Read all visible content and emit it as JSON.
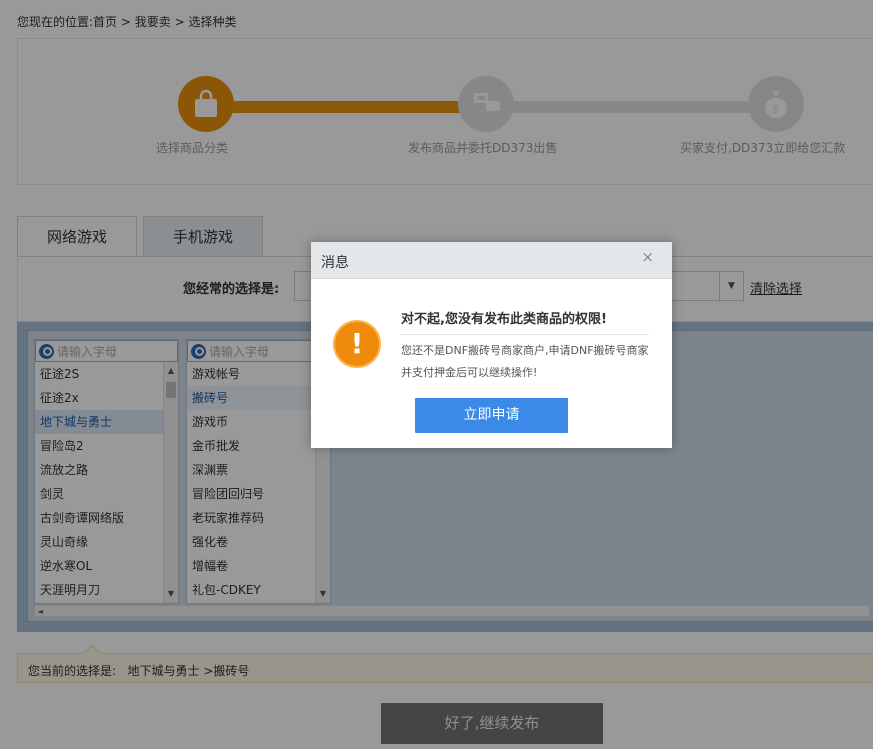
{
  "breadcrumb": {
    "prefix": "您现在的位置:",
    "home": "首页",
    "sep1": ">",
    "sell": "我要卖",
    "sep2": ">",
    "current": "选择种类"
  },
  "steps": [
    {
      "label": "选择商品分类",
      "icon": "shopping-bag-icon",
      "active": true
    },
    {
      "label": "发布商品并委托DD373出售",
      "icon": "handshake-icon",
      "active": false
    },
    {
      "label": "买家支付,DD373立即给您汇款",
      "icon": "money-bag-icon",
      "active": false
    }
  ],
  "tabs": {
    "online_games": "网络游戏",
    "mobile_games": "手机游戏"
  },
  "frequent": {
    "label": "您经常的选择是:",
    "clear_link": "清除选择"
  },
  "list_games": {
    "placeholder": "请输入字母",
    "items": [
      "征途2S",
      "征途2x",
      "地下城与勇士",
      "冒险岛2",
      "流放之路",
      "剑灵",
      "古剑奇谭网络版",
      "灵山奇缘",
      "逆水寒OL",
      "天涯明月刀"
    ],
    "selected_index": 2
  },
  "list_types": {
    "placeholder": "请输入字母",
    "items": [
      "游戏帐号",
      "搬砖号",
      "游戏币",
      "金币批发",
      "深渊票",
      "冒险团回归号",
      "老玩家推荐码",
      "强化卷",
      "增幅卷",
      "礼包-CDKEY"
    ],
    "selected_index": 1
  },
  "current_selection": {
    "label": "您当前的选择是:",
    "value": "地下城与勇士 >搬砖号"
  },
  "continue_button": "好了,继续发布",
  "dialog": {
    "title": "消息",
    "close": "×",
    "icon": "warning-icon",
    "message": "对不起,您没有发布此类商品的权限!",
    "description": "您还不是DNF搬砖号商家商户,申请DNF搬砖号商家并支付押金后可以继续操作!",
    "apply_button": "立即申请"
  },
  "colors": {
    "accent_orange": "#e8900c",
    "dialog_button": "#3c8ae8",
    "list_background": "#a9c0d6"
  }
}
